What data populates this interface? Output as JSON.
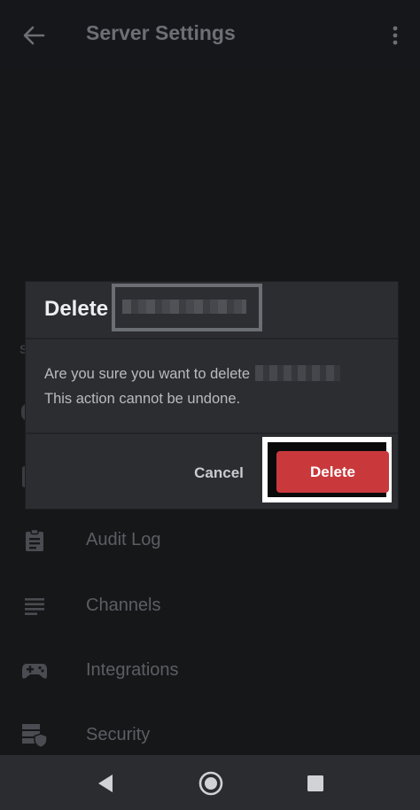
{
  "header": {
    "title": "Server Settings"
  },
  "background": {
    "section_letter": "S",
    "menu_items": [
      {
        "label": "Audit Log",
        "icon": "clipboard-icon"
      },
      {
        "label": "Channels",
        "icon": "list-icon"
      },
      {
        "label": "Integrations",
        "icon": "gamepad-icon"
      },
      {
        "label": "Security",
        "icon": "server-shield-icon"
      }
    ]
  },
  "dialog": {
    "title": "Delete",
    "body_line1": "Are you sure you want to delete",
    "body_line2": "This action cannot be undone.",
    "cancel_label": "Cancel",
    "delete_label": "Delete"
  },
  "colors": {
    "delete_button": "#c9393c",
    "dialog_bg": "#2b2d31",
    "screen_bg": "#161719",
    "highlight": "#ffffff"
  },
  "nav": {
    "icons": [
      "back-triangle-icon",
      "home-circle-icon",
      "recents-square-icon"
    ]
  }
}
